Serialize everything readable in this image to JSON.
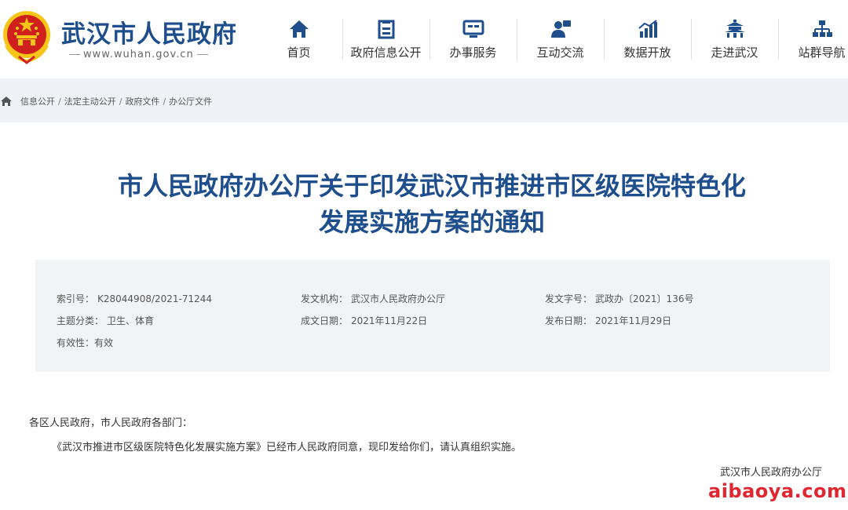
{
  "header": {
    "site_name": "武汉市人民政府",
    "site_url": "www.wuhan.gov.cn",
    "nav": [
      {
        "label": "首页",
        "icon": "home-icon"
      },
      {
        "label": "政府信息公开",
        "icon": "bookmark-icon"
      },
      {
        "label": "办事服务",
        "icon": "monitor-icon"
      },
      {
        "label": "互动交流",
        "icon": "interaction-icon"
      },
      {
        "label": "数据开放",
        "icon": "bar-chart-icon"
      },
      {
        "label": "走进武汉",
        "icon": "pavilion-icon"
      },
      {
        "label": "站群导航",
        "icon": "sitemap-icon"
      }
    ]
  },
  "breadcrumb": [
    "信息公开",
    "法定主动公开",
    "政府文件",
    "办公厅文件"
  ],
  "breadcrumb_sep": "/",
  "title": {
    "line1": "市人民政府办公厅关于印发武汉市推进市区级医院特色化",
    "line2": "发展实施方案的通知"
  },
  "meta": {
    "index_label": "索引号：",
    "index_value": "K28044908/2021-71244",
    "issuer_label": "发文机构：",
    "issuer_value": "武汉市人民政府办公厅",
    "doc_no_label": "发文字号：",
    "doc_no_value": "武政办〔2021〕136号",
    "topic_label": "主题分类：",
    "topic_value": "卫生、体育",
    "written_label": "成文日期：",
    "written_value": "2021年11月22日",
    "published_label": "发布日期：",
    "published_value": "2021年11月29日",
    "validity_label": "有效性：",
    "validity_value": "有效"
  },
  "body": {
    "salutation": "各区人民政府，市人民政府各部门：",
    "paragraph": "《武汉市推进市区级医院特色化发展实施方案》已经市人民政府同意，现印发给你们，请认真组织实施。",
    "signature": "武汉市人民政府办公厅"
  },
  "watermark": "aibaoya.com",
  "colors": {
    "brand_blue": "#1f4e8c",
    "crumb_bg": "#eef1f6",
    "meta_bg": "#f2f3f6",
    "emblem_red": "#d0201e",
    "emblem_gold": "#f5c518",
    "watermark_red": "#e0262f"
  }
}
